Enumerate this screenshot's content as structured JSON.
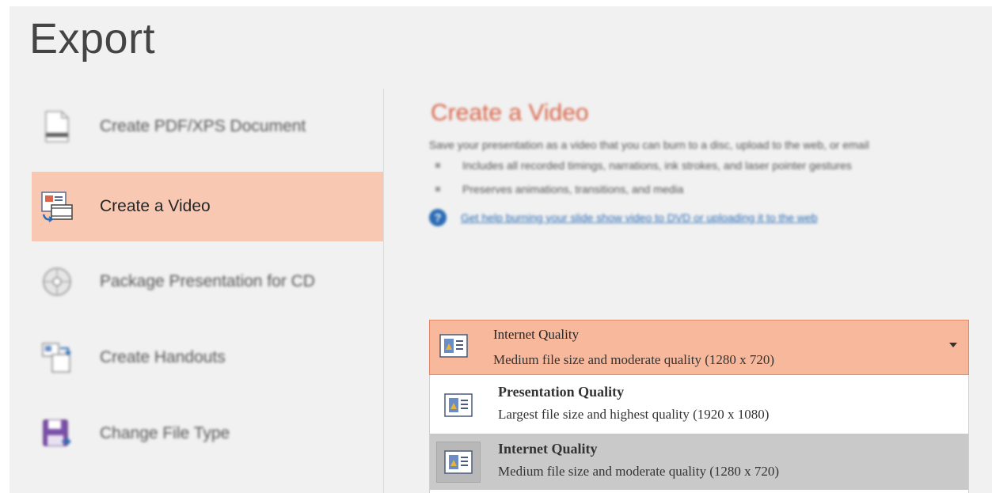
{
  "page": {
    "title": "Export"
  },
  "nav": {
    "items": [
      {
        "label": "Create PDF/XPS Document",
        "icon": "pdf-document-icon"
      },
      {
        "label": "Create a Video",
        "icon": "video-icon"
      },
      {
        "label": "Package Presentation for CD",
        "icon": "cd-package-icon"
      },
      {
        "label": "Create Handouts",
        "icon": "handouts-icon"
      },
      {
        "label": "Change File Type",
        "icon": "save-file-type-icon"
      }
    ],
    "selected": "Create a Video"
  },
  "main": {
    "heading": "Create a Video",
    "description": "Save your presentation as a video that you can burn to a disc, upload to the web, or email",
    "bullets": [
      "Includes all recorded timings, narrations, ink strokes, and laser pointer gestures",
      "Preserves animations, transitions, and media"
    ],
    "help_link": "Get help burning your slide show video to DVD or uploading it to the web",
    "help_icon": "help-icon"
  },
  "quality": {
    "selected_title": "Internet Quality",
    "selected_sub": "Medium file size and moderate quality (1280 x 720)",
    "options": [
      {
        "title": "Presentation Quality",
        "sub": "Largest file size and highest quality (1920 x 1080)"
      },
      {
        "title": "Internet Quality",
        "sub": "Medium file size and moderate quality (1280 x 720)"
      }
    ],
    "highlighted_option": "Internet Quality"
  },
  "colors": {
    "accent_heading": "#d9664a",
    "selected_nav_bg": "#f9c8b2",
    "select_bg": "#f7b89c",
    "select_border": "#e4886a",
    "option_hover_bg": "#c9c9c9",
    "link": "#2b6cb5"
  }
}
